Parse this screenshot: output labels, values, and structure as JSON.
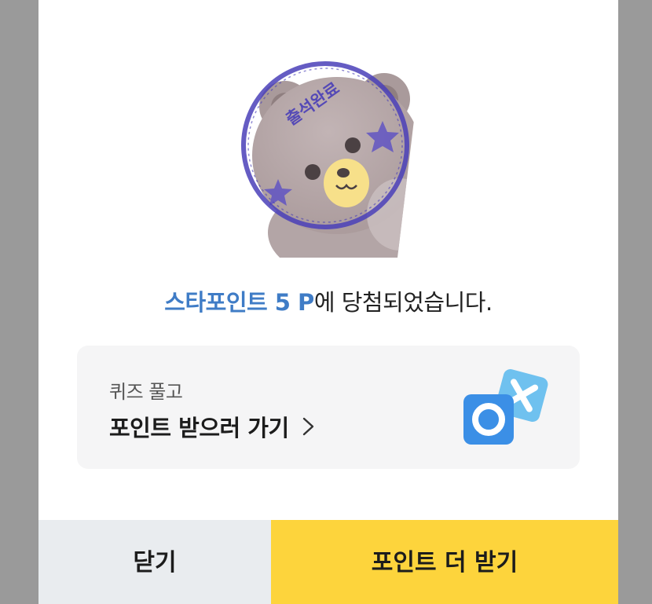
{
  "result": {
    "prize_highlight": "스타포인트 5 P",
    "prize_suffix": "에 당첨되었습니다."
  },
  "stamp": {
    "label": "출석완료",
    "color": "#4a3fb8"
  },
  "quiz_card": {
    "subtitle": "퀴즈 풀고",
    "title": "포인트 받으러 가기",
    "icon": "ox-quiz-icon"
  },
  "buttons": {
    "close_label": "닫기",
    "more_label": "포인트 더 받기"
  },
  "colors": {
    "accent_blue": "#3f7cc6",
    "primary_yellow": "#fdd43c",
    "secondary_gray": "#e9ecef",
    "overlay": "#9a9a9a"
  }
}
